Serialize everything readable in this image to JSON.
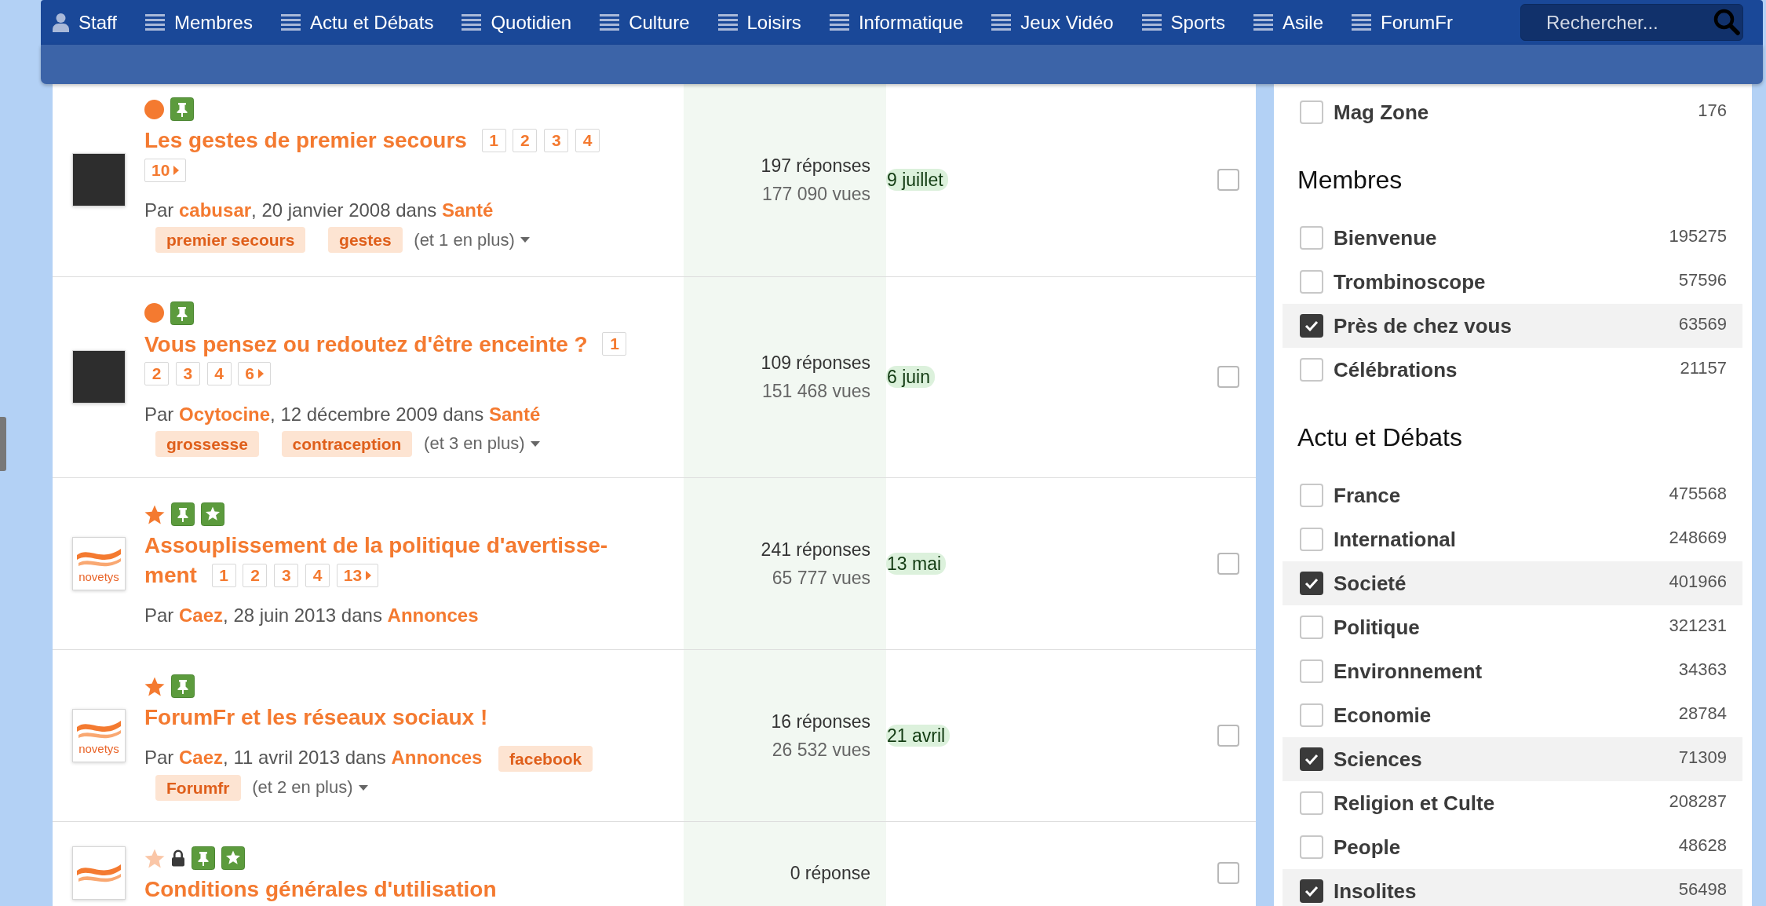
{
  "nav": {
    "items": [
      {
        "kind": "user",
        "label": "Staff"
      },
      {
        "kind": "menu",
        "label": "Membres"
      },
      {
        "kind": "menu",
        "label": "Actu et Débats"
      },
      {
        "kind": "menu",
        "label": "Quotidien"
      },
      {
        "kind": "menu",
        "label": "Culture"
      },
      {
        "kind": "menu",
        "label": "Loisirs"
      },
      {
        "kind": "menu",
        "label": "Informatique"
      },
      {
        "kind": "menu",
        "label": "Jeux Vidéo"
      },
      {
        "kind": "menu",
        "label": "Sports"
      },
      {
        "kind": "menu",
        "label": "Asile"
      },
      {
        "kind": "menu",
        "label": "ForumFr"
      }
    ],
    "search": {
      "placeholder": "Rechercher..."
    }
  },
  "topics": [
    {
      "badges": [
        {
          "kind": "unread",
          "faded": false
        },
        {
          "kind": "pinned",
          "faded": false
        }
      ],
      "avatar": {
        "kind": "photo"
      },
      "title_lines": [
        "Les gestes de premier secours"
      ],
      "pages": [
        {
          "label": "1",
          "more": false
        },
        {
          "label": "2",
          "more": false
        },
        {
          "label": "3",
          "more": false
        },
        {
          "label": "4",
          "more": false
        },
        {
          "label": "10",
          "more": true
        }
      ],
      "byline": "Par **cabusar**, 20 janvier 2008 dans **Santé**",
      "tags": [
        "premier secours",
        "gestes"
      ],
      "more_tags": "(et 1 en plus)",
      "replies": "197 réponses",
      "views": "177 090 vues",
      "last_post": "9 juillet",
      "checked": false
    },
    {
      "badges": [
        {
          "kind": "unread",
          "faded": false
        },
        {
          "kind": "pinned",
          "faded": false
        }
      ],
      "avatar": {
        "kind": "photo"
      },
      "title_lines": [
        "Vous pensez ou redoutez d'être enceinte ?"
      ],
      "pages": [
        {
          "label": "1",
          "more": false
        },
        {
          "label": "2",
          "more": false
        },
        {
          "label": "3",
          "more": false
        },
        {
          "label": "4",
          "more": false
        },
        {
          "label": "6",
          "more": true
        }
      ],
      "byline": "Par **Ocytocine**, 12 décembre 2009 dans **Santé**",
      "tags": [
        "grossesse",
        "contraception"
      ],
      "more_tags": "(et 3 en plus)",
      "replies": "109 réponses",
      "views": "151 468 vues",
      "last_post": "6 juin",
      "checked": false
    },
    {
      "badges": [
        {
          "kind": "followed",
          "faded": false
        },
        {
          "kind": "pinned",
          "faded": false
        },
        {
          "kind": "featured",
          "faded": false
        }
      ],
      "avatar": {
        "kind": "logo",
        "text": "novetys"
      },
      "title_lines": [
        "Assouplissement de la politique d'avertisse-",
        "ment"
      ],
      "pages": [
        {
          "label": "1",
          "more": false
        },
        {
          "label": "2",
          "more": false
        },
        {
          "label": "3",
          "more": false
        },
        {
          "label": "4",
          "more": false
        },
        {
          "label": "13",
          "more": true
        }
      ],
      "byline": "Par **Caez**, 28 juin 2013 dans **Annonces**",
      "replies": "241 réponses",
      "views": "65 777 vues",
      "last_post": "13 mai",
      "checked": false
    },
    {
      "badges": [
        {
          "kind": "followed",
          "faded": false
        },
        {
          "kind": "pinned",
          "faded": false
        }
      ],
      "avatar": {
        "kind": "logo",
        "text": "novetys"
      },
      "title_lines": [
        "ForumFr et les réseaux sociaux !"
      ],
      "byline": "Par **Caez**, 11 avril 2013 dans **Annonces**",
      "tags": [
        "facebook",
        "Forumfr"
      ],
      "more_tags": "(et 2 en plus)",
      "replies": "16 réponses",
      "views": "26 532 vues",
      "last_post": "21 avril",
      "checked": false
    },
    {
      "badges": [
        {
          "kind": "followed",
          "faded": true
        },
        {
          "kind": "locked",
          "faded": false
        },
        {
          "kind": "pinned",
          "faded": false
        },
        {
          "kind": "featured",
          "faded": false
        }
      ],
      "avatar": {
        "kind": "logo"
      },
      "title_lines": [
        "Conditions générales d'utilisation"
      ],
      "replies": "0 réponse",
      "checked": false
    }
  ],
  "sidebar": {
    "groups": [
      {
        "items": [
          {
            "label": "Mag Zone",
            "count": "176",
            "checked": false
          }
        ]
      },
      {
        "heading": "Membres",
        "items": [
          {
            "label": "Bienvenue",
            "count": "195275",
            "checked": false
          },
          {
            "label": "Trombinoscope",
            "count": "57596",
            "checked": false
          },
          {
            "label": "Près de chez vous",
            "count": "63569",
            "checked": true
          },
          {
            "label": "Célébrations",
            "count": "21157",
            "checked": false
          }
        ]
      },
      {
        "heading": "Actu et Débats",
        "items": [
          {
            "label": "France",
            "count": "475568",
            "checked": false
          },
          {
            "label": "International",
            "count": "248669",
            "checked": false
          },
          {
            "label": "Societé",
            "count": "401966",
            "checked": true
          },
          {
            "label": "Politique",
            "count": "321231",
            "checked": false
          },
          {
            "label": "Environnement",
            "count": "34363",
            "checked": false
          },
          {
            "label": "Economie",
            "count": "28784",
            "checked": false
          },
          {
            "label": "Sciences",
            "count": "71309",
            "checked": true
          },
          {
            "label": "Religion et Culte",
            "count": "208287",
            "checked": false
          },
          {
            "label": "People",
            "count": "48628",
            "checked": false
          },
          {
            "label": "Insolites",
            "count": "56498",
            "checked": true
          }
        ]
      }
    ]
  }
}
